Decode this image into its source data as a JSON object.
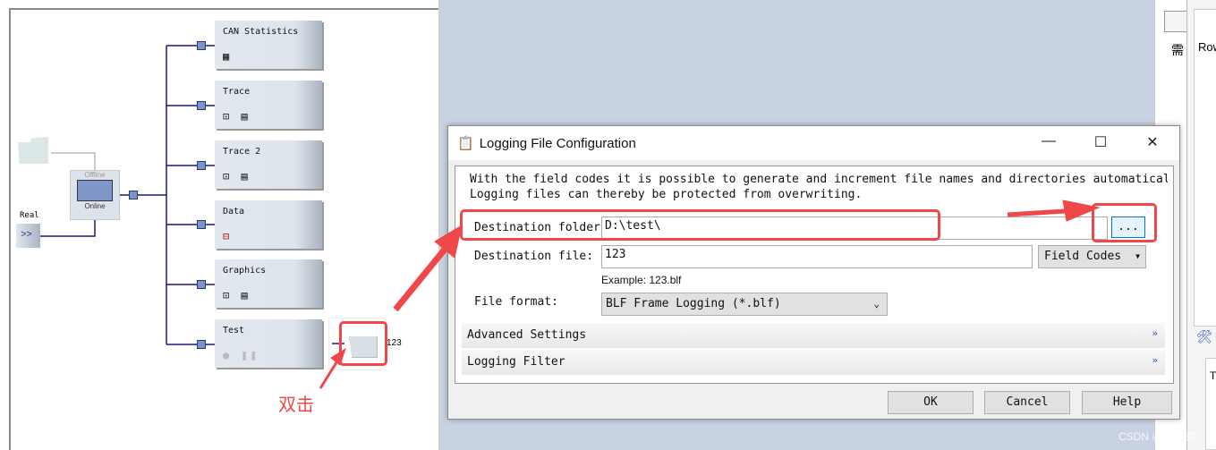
{
  "diagram": {
    "switch": {
      "offline_label": "Offline",
      "online_label": "Online"
    },
    "real_label": "Real",
    "real_button_glyph": ">>",
    "blocks": [
      {
        "title": "CAN Statistics",
        "icons": "▦"
      },
      {
        "title": "Trace",
        "icons": "⊡ ▤"
      },
      {
        "title": "Trace 2",
        "icons": "⊡ ▤"
      },
      {
        "title": "Data",
        "icons": "⊟"
      },
      {
        "title": "Graphics",
        "icons": "⊡ ▤"
      },
      {
        "title": "Test",
        "icons": "● ❚❚"
      }
    ],
    "logging_block_label": "123",
    "annotation": "双击"
  },
  "dialog": {
    "title": "Logging File Configuration",
    "description_line1": "With the field codes it is possible to generate and increment file names and directories automaticall",
    "description_line2": "Logging files can thereby be protected from overwriting.",
    "destination_folder_label": "Destination folder",
    "destination_folder_value": "D:\\test\\",
    "browse_label": "...",
    "destination_file_label": "Destination file:",
    "destination_file_value": "123",
    "field_codes_label": "Field Codes",
    "example": "Example: 123.blf",
    "file_format_label": "File format:",
    "file_format_value": "BLF Frame Logging (*.blf)",
    "advanced_settings": "Advanced Settings",
    "logging_filter": "Logging Filter",
    "ok": "OK",
    "cancel": "Cancel",
    "help": "Help"
  },
  "right_panel": {
    "cjk_label": "需",
    "rows_label": "Row",
    "bottom_label": "T"
  },
  "watermark": "CSDN @77赫兹",
  "colors": {
    "annotation_red": "#f04848",
    "connector": "#1a1a78"
  }
}
